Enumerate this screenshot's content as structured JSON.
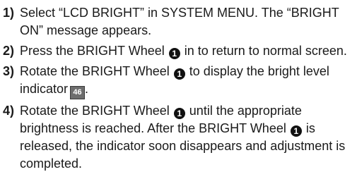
{
  "steps": [
    {
      "num": "1)",
      "parts": {
        "a": "Select “LCD BRIGHT” in SYSTEM MENU. The “BRIGHT ON” message appears."
      }
    },
    {
      "num": "2)",
      "parts": {
        "a": "Press the BRIGHT Wheel",
        "b": "in to return to normal screen."
      }
    },
    {
      "num": "3)",
      "parts": {
        "a": "Rotate the BRIGHT Wheel",
        "b": "to display the bright level indicator",
        "c": "."
      }
    },
    {
      "num": "4)",
      "parts": {
        "a": "Rotate the BRIGHT Wheel",
        "b": "until the appropriate brightness is reached. After the BRIGHT Wheel",
        "c": "is released, the indicator soon disappears and adjustment is completed."
      }
    }
  ],
  "wheel_marker": "1",
  "level_indicator": "46"
}
